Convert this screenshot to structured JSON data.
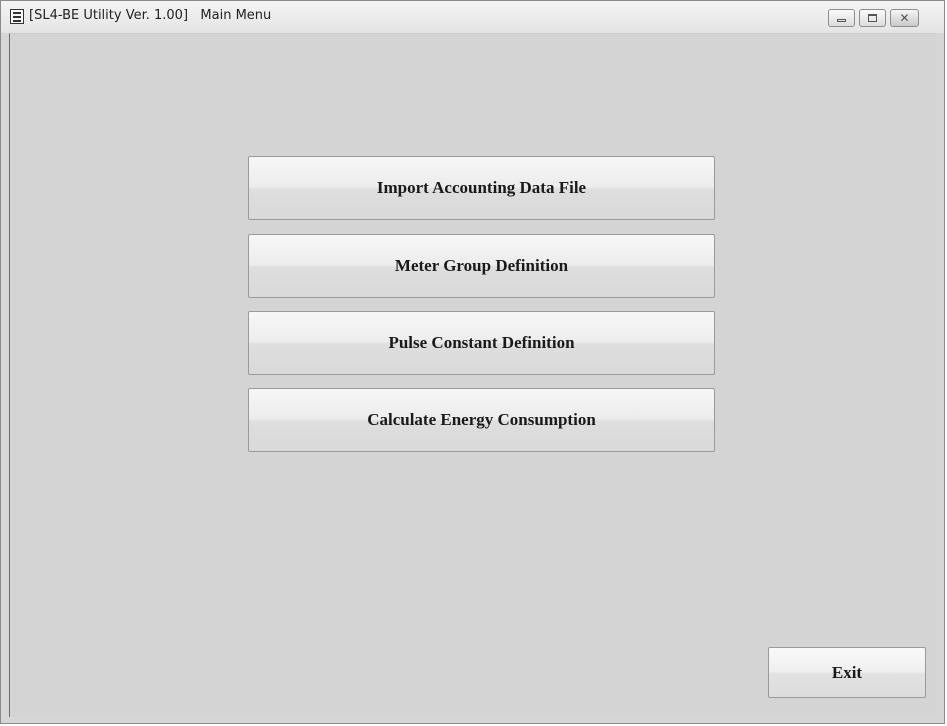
{
  "window": {
    "title": "[SL4-BE Utility Ver. 1.00]   Main Menu",
    "icon": "app-document-icon",
    "controls": {
      "minimize": "minimize-icon",
      "maximize": "maximize-icon",
      "close": "close-icon",
      "close_glyph": "✕"
    }
  },
  "menu": {
    "buttons": [
      {
        "label": "Import Accounting Data File"
      },
      {
        "label": "Meter Group Definition"
      },
      {
        "label": "Pulse Constant Definition"
      },
      {
        "label": "Calculate Energy Consumption"
      }
    ]
  },
  "footer": {
    "exit_label": "Exit"
  }
}
